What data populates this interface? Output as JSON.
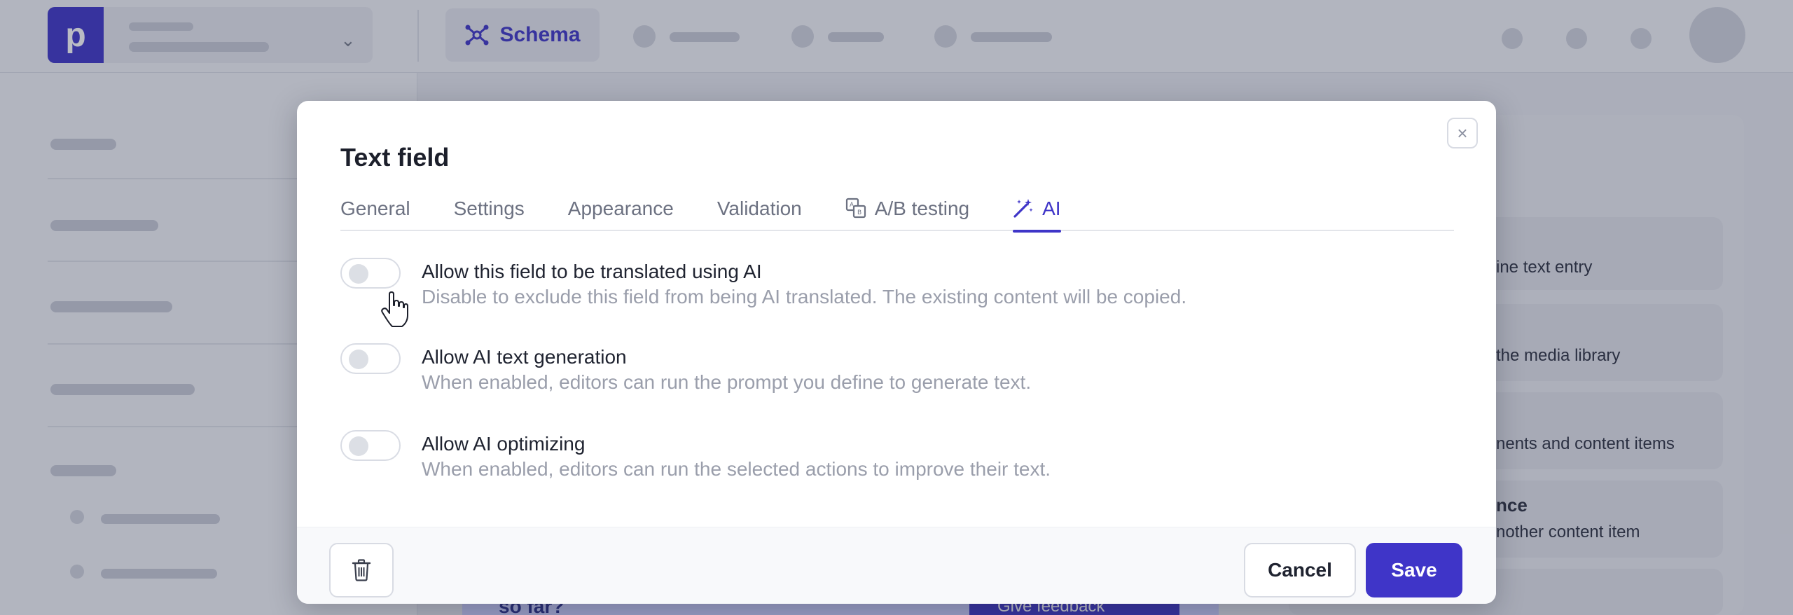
{
  "colors": {
    "accent": "#3f35c8",
    "text": "#1f2330",
    "muted": "#9a9eab"
  },
  "topbar": {
    "logo_letter": "p",
    "schema_tab": {
      "label": "Schema",
      "icon": "schema-network-icon"
    }
  },
  "background": {
    "right_panel_texts": [
      "ine text entry",
      "the media library",
      "nents and content items",
      "nce",
      "nother content item"
    ],
    "bottom_left_text": "so far?",
    "feedback_label": "Give feedback"
  },
  "modal": {
    "title": "Text field",
    "close_icon": "close-icon",
    "tabs": [
      {
        "label": "General",
        "icon": "",
        "active": false
      },
      {
        "label": "Settings",
        "icon": "",
        "active": false
      },
      {
        "label": "Appearance",
        "icon": "",
        "active": false
      },
      {
        "label": "Validation",
        "icon": "",
        "active": false
      },
      {
        "label": "A/B testing",
        "icon": "ab-testing-icon",
        "active": false
      },
      {
        "label": "AI",
        "icon": "magic-wand-icon",
        "active": true
      }
    ],
    "options": [
      {
        "title": "Allow this field to be translated using AI",
        "description": "Disable to exclude this field from being AI translated. The existing content will be copied.",
        "enabled": false
      },
      {
        "title": "Allow AI text generation",
        "description": "When enabled, editors can run the prompt you define to generate text.",
        "enabled": false
      },
      {
        "title": "Allow AI optimizing",
        "description": "When enabled, editors can run the selected actions to improve their text.",
        "enabled": false
      }
    ],
    "footer": {
      "delete_icon": "trash-icon",
      "cancel_label": "Cancel",
      "save_label": "Save"
    }
  }
}
